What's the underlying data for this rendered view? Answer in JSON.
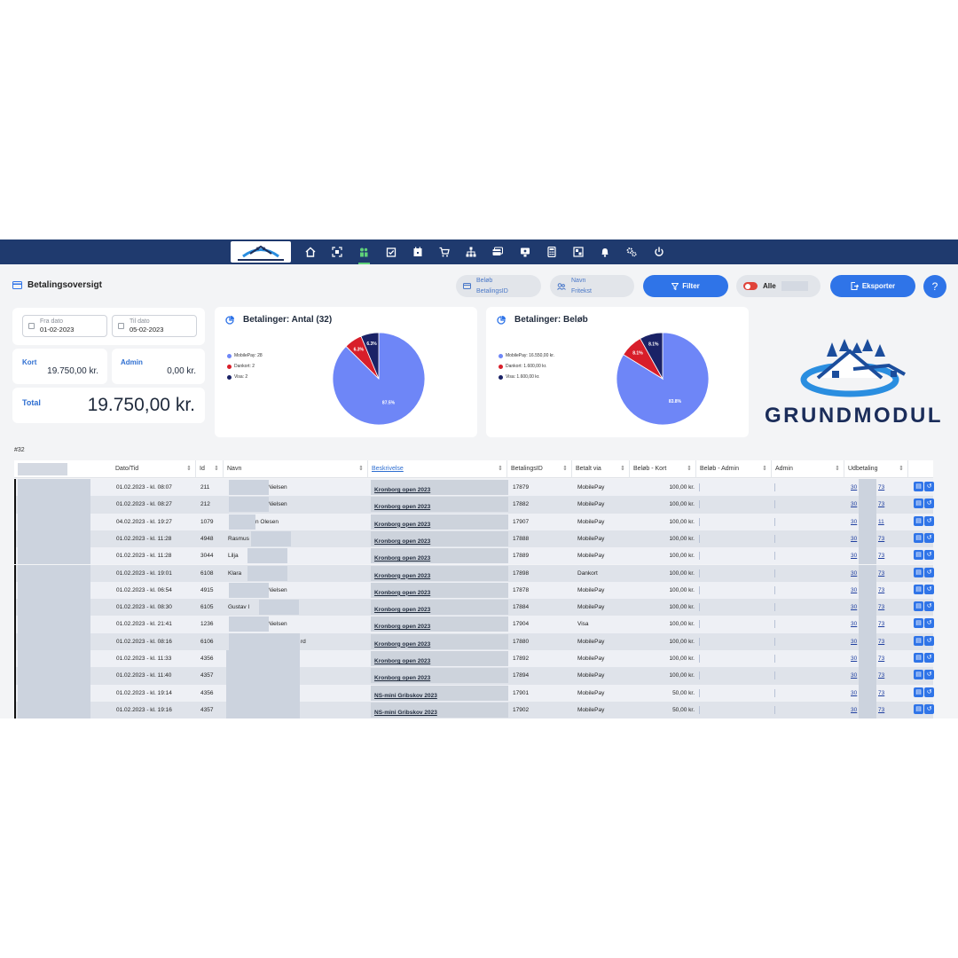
{
  "nav": {
    "items": [
      "home",
      "scanner",
      "members",
      "tasks",
      "calendar",
      "cart",
      "hierarchy",
      "payments",
      "screen",
      "calculator",
      "layout",
      "notifications",
      "settings",
      "power"
    ]
  },
  "header": {
    "title": "Betalingsoversigt",
    "search_pill_1": {
      "line1": "Beløb",
      "line2": "BetalingsID"
    },
    "search_pill_2": {
      "line1": "Navn",
      "line2": "Fritekst"
    },
    "filter_label": "Filter",
    "toggle_label": "Alle",
    "export_label": "Eksporter",
    "help_label": "?"
  },
  "dates": {
    "from_label": "Fra dato",
    "from_value": "01-02-2023",
    "to_label": "Til dato",
    "to_value": "05-02-2023"
  },
  "totals": {
    "kort_label": "Kort",
    "kort_value": "19.750,00 kr.",
    "admin_label": "Admin",
    "admin_value": "0,00 kr.",
    "total_label": "Total",
    "total_value": "19.750,00 kr."
  },
  "chart_data": [
    {
      "type": "pie",
      "title": "Betalinger: Antal (32)",
      "legend": [
        "MobilePay: 28",
        "Dankort: 2",
        "Visa: 2"
      ],
      "labels": [
        "MobilePay",
        "Dankort",
        "Visa"
      ],
      "values": [
        87.5,
        6.3,
        6.3
      ],
      "value_labels": [
        "87.5%",
        "6.3%",
        "6.3%"
      ],
      "colors": [
        "#6e86f7",
        "#d81e2a",
        "#1a2266"
      ]
    },
    {
      "type": "pie",
      "title": "Betalinger: Beløb",
      "legend": [
        "MobilePay: 16.550,00 kr.",
        "Dankort: 1.600,00 kr.",
        "Visa: 1.600,00 kr."
      ],
      "labels": [
        "MobilePay",
        "Dankort",
        "Visa"
      ],
      "values": [
        83.8,
        8.1,
        8.1
      ],
      "value_labels": [
        "83.8%",
        "8.1%",
        "8.1%"
      ],
      "colors": [
        "#6e86f7",
        "#d81e2a",
        "#1a2266"
      ]
    }
  ],
  "brand": {
    "name": "GRUNDMODUL"
  },
  "table": {
    "count": "#32",
    "headers": [
      "Dato/Tid",
      "Id",
      "Navn",
      "Beskrivelse",
      "BetalingsID",
      "Betalt via",
      "Beløb - Kort",
      "Beløb - Admin",
      "Admin",
      "Udbetaling"
    ],
    "rows": [
      {
        "date": "01.02.2023 - kl. 08:07",
        "id": "211",
        "name": "Nielsen",
        "desc": "Kronborg open 2023",
        "bid": "17879",
        "via": "MobilePay",
        "amount": "100,00 kr.",
        "udb_a": "30",
        "udb_b": "73"
      },
      {
        "date": "01.02.2023 - kl. 08:27",
        "id": "212",
        "name": "Nielsen",
        "desc": "Kronborg open 2023",
        "bid": "17882",
        "via": "MobilePay",
        "amount": "100,00 kr.",
        "udb_a": "30",
        "udb_b": "73"
      },
      {
        "date": "04.02.2023 - kl. 19:27",
        "id": "1079",
        "name": "n Olesen",
        "desc": "Kronborg open 2023",
        "bid": "17907",
        "via": "MobilePay",
        "amount": "100,00 kr.",
        "udb_a": "30",
        "udb_b": "11"
      },
      {
        "date": "01.02.2023 - kl. 11:28",
        "id": "4948",
        "name": "Rasmus",
        "desc": "Kronborg open 2023",
        "bid": "17888",
        "via": "MobilePay",
        "amount": "100,00 kr.",
        "udb_a": "30",
        "udb_b": "73"
      },
      {
        "date": "01.02.2023 - kl. 11:28",
        "id": "3044",
        "name": "Lilja",
        "desc": "Kronborg open 2023",
        "bid": "17889",
        "via": "MobilePay",
        "amount": "100,00 kr.",
        "udb_a": "30",
        "udb_b": "73"
      },
      {
        "date": "01.02.2023 - kl. 19:01",
        "id": "6108",
        "name": "Klara",
        "desc": "Kronborg open 2023",
        "bid": "17898",
        "via": "Dankort",
        "amount": "100,00 kr.",
        "udb_a": "30",
        "udb_b": "73"
      },
      {
        "date": "01.02.2023 - kl. 06:54",
        "id": "4915",
        "name": "Nielsen",
        "desc": "Kronborg open 2023",
        "bid": "17878",
        "via": "MobilePay",
        "amount": "100,00 kr.",
        "udb_a": "30",
        "udb_b": "73"
      },
      {
        "date": "01.02.2023 - kl. 08:30",
        "id": "6105",
        "name": "Gustav I",
        "desc": "Kronborg open 2023",
        "bid": "17884",
        "via": "MobilePay",
        "amount": "100,00 kr.",
        "udb_a": "30",
        "udb_b": "73"
      },
      {
        "date": "01.02.2023 - kl. 21:41",
        "id": "1236",
        "name": "Nielsen",
        "desc": "Kronborg open 2023",
        "bid": "17904",
        "via": "Visa",
        "amount": "100,00 kr.",
        "udb_a": "30",
        "udb_b": "73"
      },
      {
        "date": "01.02.2023 - kl. 08:16",
        "id": "6106",
        "name": "rd",
        "desc": "Kronborg open 2023",
        "bid": "17880",
        "via": "MobilePay",
        "amount": "100,00 kr.",
        "udb_a": "30",
        "udb_b": "73"
      },
      {
        "date": "01.02.2023 - kl. 11:33",
        "id": "4356",
        "name": "",
        "desc": "Kronborg open 2023",
        "bid": "17892",
        "via": "MobilePay",
        "amount": "100,00 kr.",
        "udb_a": "30",
        "udb_b": "73"
      },
      {
        "date": "01.02.2023 - kl. 11:40",
        "id": "4357",
        "name": "",
        "desc": "Kronborg open 2023",
        "bid": "17894",
        "via": "MobilePay",
        "amount": "100,00 kr.",
        "udb_a": "30",
        "udb_b": "73"
      },
      {
        "date": "01.02.2023 - kl. 19:14",
        "id": "4356",
        "name": "",
        "desc": "NS-mini Gribskov 2023",
        "bid": "17901",
        "via": "MobilePay",
        "amount": "50,00 kr.",
        "udb_a": "30",
        "udb_b": "73"
      },
      {
        "date": "01.02.2023 - kl. 19:16",
        "id": "4357",
        "name": "",
        "desc": "NS-mini Gribskov 2023",
        "bid": "17902",
        "via": "MobilePay",
        "amount": "50,00 kr.",
        "udb_a": "30",
        "udb_b": "73"
      }
    ]
  }
}
